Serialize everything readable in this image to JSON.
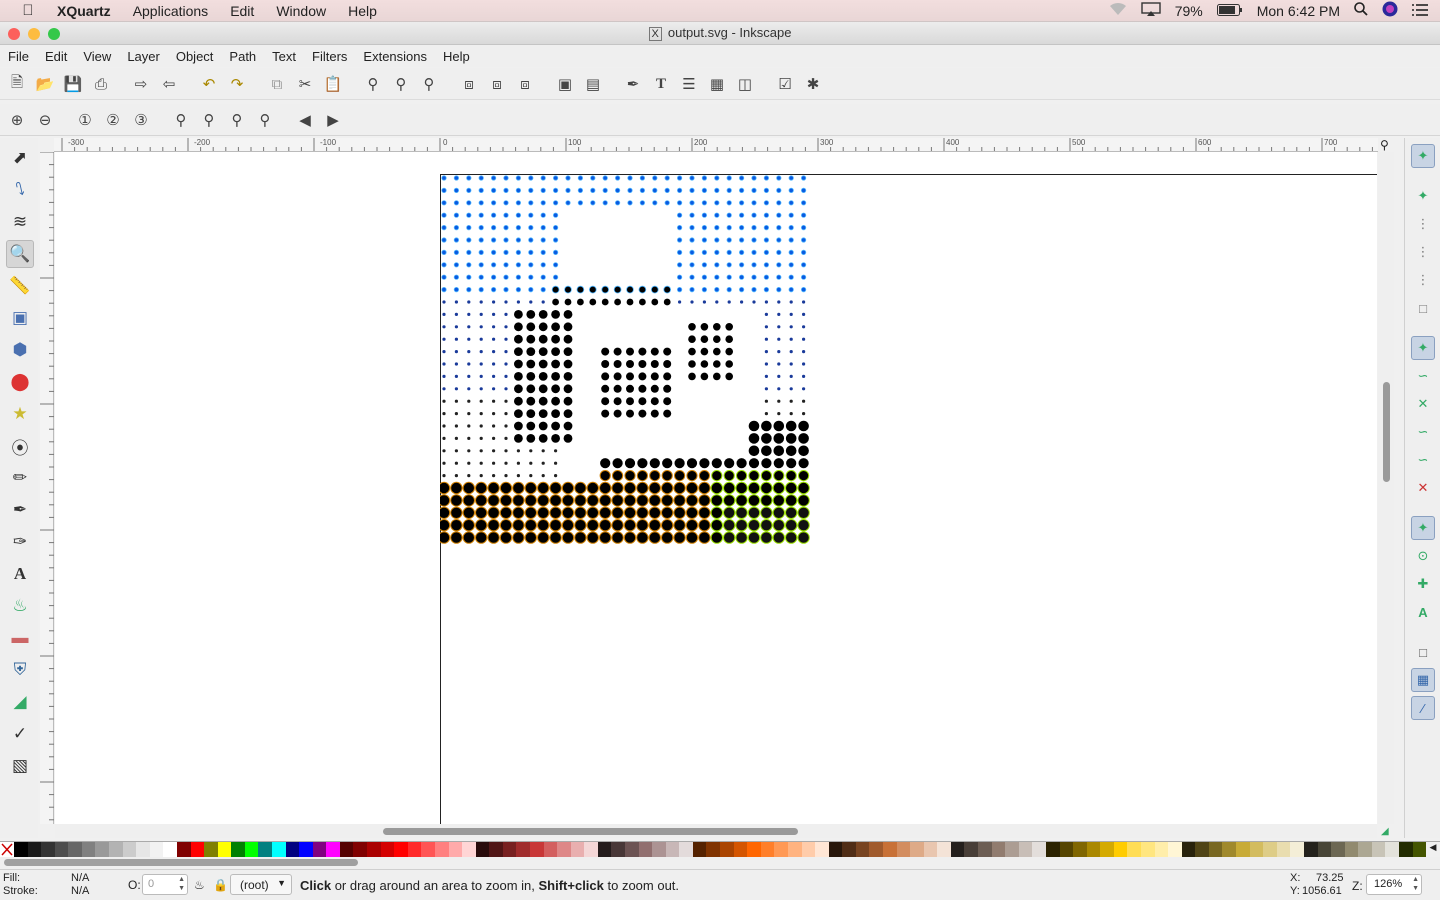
{
  "macmenu": {
    "app_name": "XQuartz",
    "items": [
      "Applications",
      "Edit",
      "Window",
      "Help"
    ],
    "battery": "79%",
    "clock": "Mon 6:42 PM"
  },
  "window": {
    "title": "output.svg - Inkscape",
    "title_icon": "X"
  },
  "menubar": [
    "File",
    "Edit",
    "View",
    "Layer",
    "Object",
    "Path",
    "Text",
    "Filters",
    "Extensions",
    "Help"
  ],
  "ruler": {
    "labels": [
      "-300",
      "-200",
      "-100",
      "0",
      "100",
      "200",
      "300",
      "400",
      "500",
      "600",
      "700"
    ]
  },
  "statusbar": {
    "fill_label": "Fill:",
    "fill_value": "N/A",
    "stroke_label": "Stroke:",
    "stroke_value": "N/A",
    "opacity_label": "O:",
    "opacity_value": "0",
    "layer_value": "(root)",
    "message_bold1": "Click",
    "message_part1": " or drag around an area to zoom in, ",
    "message_bold2": "Shift+click",
    "message_part2": " to zoom out.",
    "x_label": "X:",
    "x_value": "73.25",
    "y_label": "Y:",
    "y_value": "1056.61",
    "zoom_label": "Z:",
    "zoom_value": "126%"
  },
  "colors": {
    "close": "#fc605c",
    "minimize": "#fdbc40",
    "zoom": "#34c84a",
    "palette": [
      "#000000",
      "#1a1a1a",
      "#333333",
      "#4d4d4d",
      "#666666",
      "#808080",
      "#999999",
      "#b3b3b3",
      "#cccccc",
      "#e6e6e6",
      "#f2f2f2",
      "#ffffff",
      "#800000",
      "#ff0000",
      "#808000",
      "#ffff00",
      "#008000",
      "#00ff00",
      "#008080",
      "#00ffff",
      "#000080",
      "#0000ff",
      "#800080",
      "#ff00ff",
      "#550000",
      "#800000",
      "#aa0000",
      "#d40000",
      "#ff0000",
      "#ff2a2a",
      "#ff5555",
      "#ff8080",
      "#ffaaaa",
      "#ffd5d5",
      "#280b0b",
      "#501616",
      "#782121",
      "#a02c2c",
      "#c83737",
      "#d35f5f",
      "#de8787",
      "#e9afaf",
      "#f4d7d7",
      "#241c1c",
      "#483737",
      "#6c5353",
      "#916f6f",
      "#ac9393",
      "#c8b7b7",
      "#e3dbdb",
      "#552200",
      "#803300",
      "#aa4400",
      "#d45500",
      "#ff6600",
      "#ff7f2a",
      "#ff9955",
      "#ffb380",
      "#ffccaa",
      "#ffe6d5",
      "#28170b",
      "#502d16",
      "#784421",
      "#a05a2c",
      "#c87137",
      "#d38d5f",
      "#deaa87",
      "#e9c6af",
      "#f4e3d7",
      "#241f1c",
      "#483e37",
      "#6c5d53",
      "#917c6f",
      "#ac9d93",
      "#c8beb7",
      "#e3dedb",
      "#2b2200",
      "#554400",
      "#806600",
      "#aa8800",
      "#d4aa00",
      "#ffcc00",
      "#ffdd55",
      "#ffe680",
      "#ffeeaa",
      "#fff6d5",
      "#28220b",
      "#504416",
      "#786721",
      "#a0892c",
      "#c8ab37",
      "#d3bc5f",
      "#decd87",
      "#e9ddaf",
      "#f4eed7",
      "#24221c",
      "#484537",
      "#6c6753",
      "#918a6f",
      "#aca793",
      "#c8c4b7",
      "#e3e2db",
      "#222b00",
      "#445500"
    ]
  }
}
